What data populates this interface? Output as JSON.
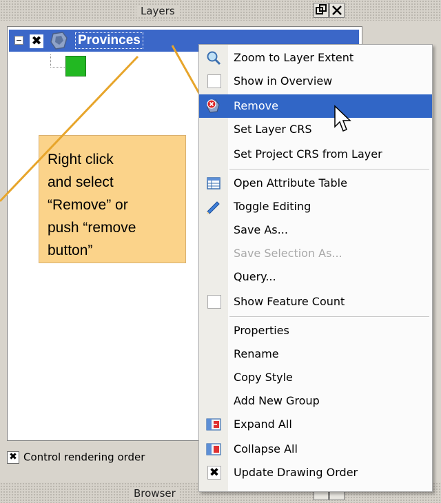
{
  "layers_dock": {
    "title": "Layers",
    "float_icon": "float-icon",
    "close_icon": "close-icon",
    "layer": {
      "name": "Provinces",
      "expand_symbol": "−",
      "visible_mark": "✖",
      "layer_icon": "vector-layer-icon",
      "symbol_color": "#22b822"
    },
    "control_rendering_order": {
      "label": "Control rendering order",
      "checked": true,
      "mark": "✖"
    }
  },
  "browser_dock": {
    "title": "Browser"
  },
  "callout": {
    "lines": [
      "Right click",
      "and select",
      "“Remove” or",
      "push “remove",
      "button”"
    ],
    "color": "#fbd38a",
    "arrow_color": "#e7a52b"
  },
  "context_menu": {
    "items": [
      {
        "label": "Zoom to Layer Extent",
        "icon": "zoom-icon",
        "state": "normal"
      },
      {
        "label": "Show in Overview",
        "icon": "checkbox-unchecked",
        "state": "normal"
      },
      {
        "label": "Remove",
        "icon": "remove-icon",
        "state": "highlighted"
      },
      {
        "label": "Set Layer CRS",
        "icon": "",
        "state": "normal"
      },
      {
        "label": "Set Project CRS from Layer",
        "icon": "",
        "state": "normal"
      },
      {
        "label": "Open Attribute Table",
        "icon": "table-icon",
        "state": "normal"
      },
      {
        "label": "Toggle Editing",
        "icon": "pencil-icon",
        "state": "normal"
      },
      {
        "label": "Save As...",
        "icon": "",
        "state": "normal"
      },
      {
        "label": "Save Selection As...",
        "icon": "",
        "state": "disabled"
      },
      {
        "label": "Query...",
        "icon": "",
        "state": "normal"
      },
      {
        "label": "Show Feature Count",
        "icon": "checkbox-unchecked",
        "state": "normal"
      },
      {
        "label": "Properties",
        "icon": "",
        "state": "normal"
      },
      {
        "label": "Rename",
        "icon": "",
        "state": "normal"
      },
      {
        "label": "Copy Style",
        "icon": "",
        "state": "normal"
      },
      {
        "label": "Add New Group",
        "icon": "",
        "state": "normal"
      },
      {
        "label": "Expand All",
        "icon": "expand-icon",
        "state": "normal"
      },
      {
        "label": "Collapse All",
        "icon": "collapse-icon",
        "state": "normal"
      },
      {
        "label": "Update Drawing Order",
        "icon": "checkbox-checked",
        "state": "normal",
        "mark": "✖"
      }
    ],
    "highlight_color": "#3166c6"
  }
}
